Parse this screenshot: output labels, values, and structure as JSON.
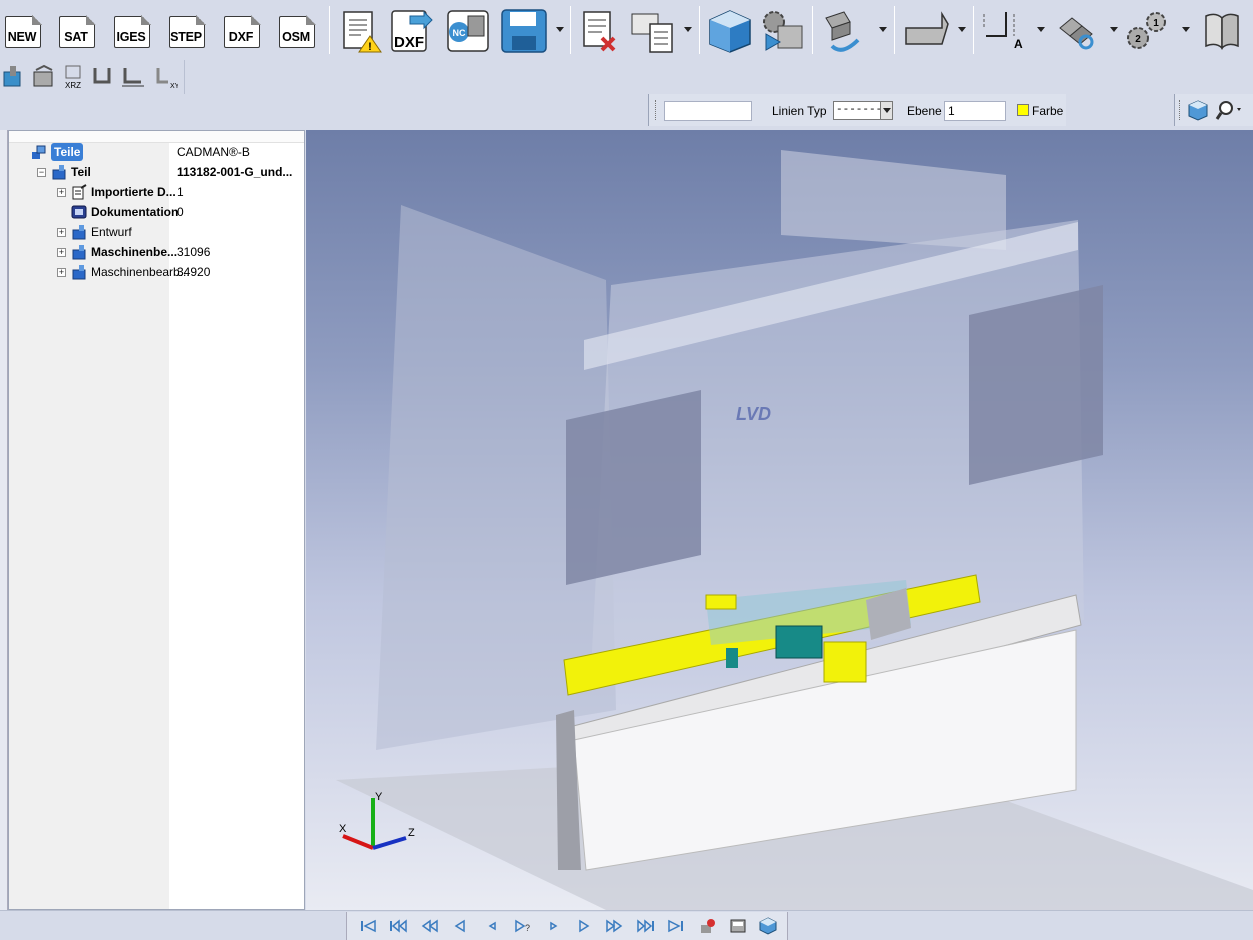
{
  "toolbar": {
    "file_buttons": [
      {
        "id": "new",
        "label": "NEW"
      },
      {
        "id": "sat",
        "label": "SAT"
      },
      {
        "id": "iges",
        "label": "IGES"
      },
      {
        "id": "step",
        "label": "STEP"
      },
      {
        "id": "dxf",
        "label": "DXF"
      },
      {
        "id": "osm",
        "label": "OSM"
      }
    ],
    "export_dxf_label": "DXF",
    "nc_label": "NC"
  },
  "props_bar": {
    "layer_name_value": "",
    "linetype_label": "Linien Typ",
    "linetype_value": "---------",
    "layer_label": "Ebene",
    "layer_value": "1",
    "color_label": "Farbe",
    "color_value": "#ffff00"
  },
  "tree": {
    "rows": [
      {
        "name": "Teile",
        "value": "CADMAN®-B",
        "bold": true,
        "selected": true,
        "indent": 0,
        "expander": "",
        "icon": "parts-icon"
      },
      {
        "name": "Teil",
        "value": "113182-001-G_und...",
        "bold": true,
        "indent": 1,
        "expander": "-",
        "icon": "part-icon"
      },
      {
        "name": "Importierte D...",
        "value": "1",
        "bold": true,
        "indent": 2,
        "expander": "+",
        "icon": "import-icon"
      },
      {
        "name": "Dokumentation",
        "value": "0",
        "bold": true,
        "indent": 2,
        "expander": "",
        "icon": "documentation-icon"
      },
      {
        "name": "Entwurf",
        "value": "",
        "bold": false,
        "indent": 2,
        "expander": "+",
        "icon": "design-icon"
      },
      {
        "name": "Maschinenbe...",
        "value": "31096",
        "bold": true,
        "indent": 2,
        "expander": "+",
        "icon": "machining-icon"
      },
      {
        "name": "Maschinenbearb...",
        "value": "34920",
        "bold": false,
        "indent": 2,
        "expander": "+",
        "icon": "machining-icon"
      }
    ]
  },
  "viewport": {
    "brand_text": "LVD",
    "axes": {
      "x": "X",
      "y": "Y",
      "z": "Z"
    }
  },
  "colors": {
    "background": "#d6dbe9",
    "highlight": "#3a7fd6",
    "tool_yellow": "#f2f20a"
  }
}
